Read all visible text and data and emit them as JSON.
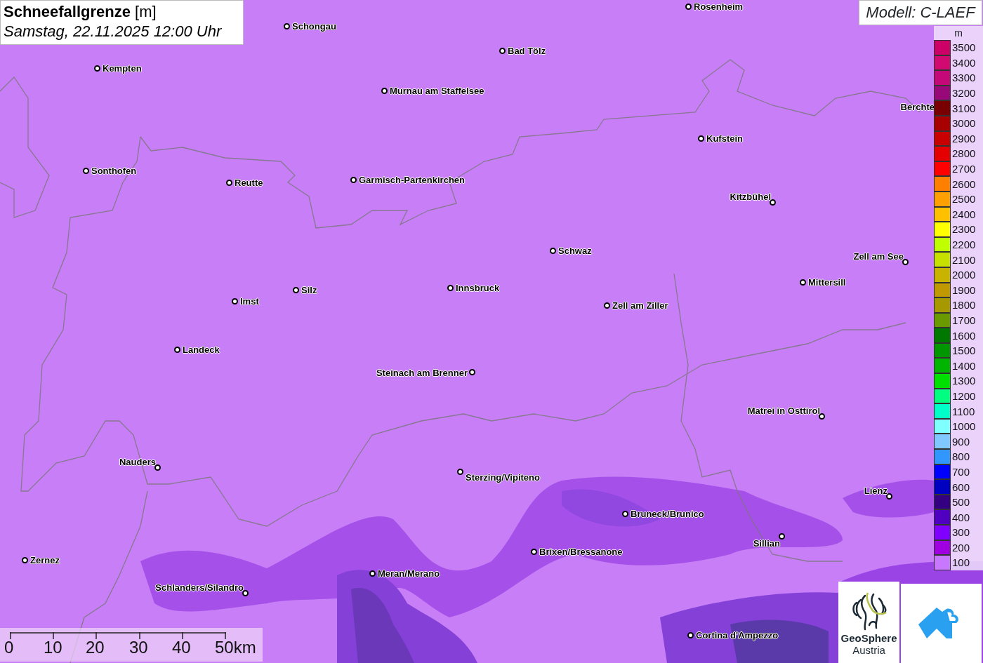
{
  "title": {
    "heading": "**Schneefallgrenze** [m]",
    "datetime": "Samstag, 22.11.2025 12:00 Uhr"
  },
  "model": "Modell: C-LAEF",
  "cities": [
    {
      "name": "Rosenheim"
    },
    {
      "name": "Schongau"
    },
    {
      "name": "Kempten"
    },
    {
      "name": "Bad Tölz"
    },
    {
      "name": "Murnau am Staffelsee"
    },
    {
      "name": "Berchte"
    },
    {
      "name": "Kufstein"
    },
    {
      "name": "Sonthofen"
    },
    {
      "name": "Reutte"
    },
    {
      "name": "Garmisch-Partenkirchen"
    },
    {
      "name": "Kitzbühel"
    },
    {
      "name": "Schwaz"
    },
    {
      "name": "Zell am See"
    },
    {
      "name": "Mittersill"
    },
    {
      "name": "Silz"
    },
    {
      "name": "Innsbruck"
    },
    {
      "name": "Imst"
    },
    {
      "name": "Zell am Ziller"
    },
    {
      "name": "Landeck"
    },
    {
      "name": "Steinach am Brenner"
    },
    {
      "name": "Matrei in Osttirol"
    },
    {
      "name": "Nauders"
    },
    {
      "name": "Sterzing/Vipiteno"
    },
    {
      "name": "Lienz"
    },
    {
      "name": "Bruneck/Brunico"
    },
    {
      "name": "Sillian"
    },
    {
      "name": "Brixen/Bressanone"
    },
    {
      "name": "Zernez"
    },
    {
      "name": "Meran/Merano"
    },
    {
      "name": "Schlanders/Silandro"
    },
    {
      "name": "Cortina d'Ampezzo"
    }
  ],
  "legend": {
    "unit": "m",
    "entries": [
      {
        "label": "3500",
        "color": "#cc0066"
      },
      {
        "label": "3400",
        "color": "#d00a70"
      },
      {
        "label": "3300",
        "color": "#c40878"
      },
      {
        "label": "3200",
        "color": "#980878"
      },
      {
        "label": "3100",
        "color": "#780000"
      },
      {
        "label": "3000",
        "color": "#a80000"
      },
      {
        "label": "2900",
        "color": "#c80000"
      },
      {
        "label": "2800",
        "color": "#e40000"
      },
      {
        "label": "2700",
        "color": "#ff0000"
      },
      {
        "label": "2600",
        "color": "#ff8000"
      },
      {
        "label": "2500",
        "color": "#ffa000"
      },
      {
        "label": "2400",
        "color": "#ffc000"
      },
      {
        "label": "2300",
        "color": "#ffff00"
      },
      {
        "label": "2200",
        "color": "#c0ff00"
      },
      {
        "label": "2100",
        "color": "#c8e000"
      },
      {
        "label": "2000",
        "color": "#c8b400"
      },
      {
        "label": "1900",
        "color": "#c09800"
      },
      {
        "label": "1800",
        "color": "#a89800"
      },
      {
        "label": "1700",
        "color": "#6a9a00"
      },
      {
        "label": "1600",
        "color": "#007800"
      },
      {
        "label": "1500",
        "color": "#009600"
      },
      {
        "label": "1400",
        "color": "#00b400"
      },
      {
        "label": "1300",
        "color": "#00e000"
      },
      {
        "label": "1200",
        "color": "#00ff80"
      },
      {
        "label": "1100",
        "color": "#00ffc8"
      },
      {
        "label": "1000",
        "color": "#80ffff"
      },
      {
        "label": "900",
        "color": "#80c8ff"
      },
      {
        "label": "800",
        "color": "#3296ff"
      },
      {
        "label": "700",
        "color": "#0000ff"
      },
      {
        "label": "600",
        "color": "#0000c0"
      },
      {
        "label": "500",
        "color": "#320080"
      },
      {
        "label": "400",
        "color": "#5000c0"
      },
      {
        "label": "300",
        "color": "#8000ff"
      },
      {
        "label": "200",
        "color": "#a000e0"
      },
      {
        "label": "100",
        "color": "#c878ff"
      }
    ]
  },
  "scale": {
    "ticks": [
      "0",
      "10",
      "20",
      "30",
      "40",
      "50km"
    ]
  },
  "logo": {
    "line1": "GeoSphere",
    "line2": "Austria"
  }
}
